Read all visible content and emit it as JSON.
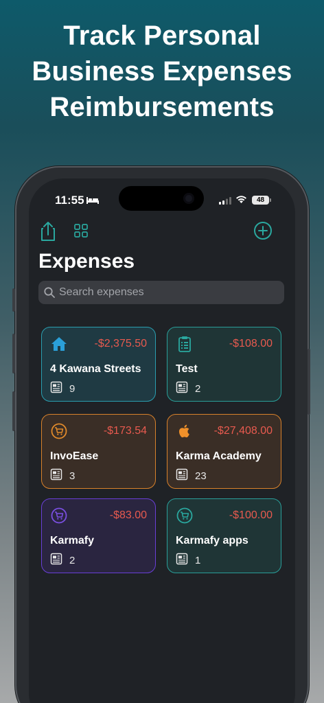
{
  "headline": {
    "line1": "Track Personal",
    "line2": "Business Expenses",
    "line3": "Reimbursements"
  },
  "status_bar": {
    "time": "11:55",
    "battery": "48"
  },
  "screen": {
    "title": "Expenses",
    "search_placeholder": "Search expenses",
    "cards": [
      {
        "name": "4 Kawana Streets",
        "amount": "-$2,375.50",
        "count": "9",
        "icon": "house-icon",
        "border": "#2a9fb0",
        "bg": "#1f3a43",
        "iconColor": "#2a9fd8"
      },
      {
        "name": "Test",
        "amount": "-$108.00",
        "count": "2",
        "icon": "clipboard-icon",
        "border": "#2a9f9a",
        "bg": "#1f3536",
        "iconColor": "#2aa89f"
      },
      {
        "name": "InvoEase",
        "amount": "-$173.54",
        "count": "3",
        "icon": "cart-icon",
        "border": "#d9822b",
        "bg": "#3a2e26",
        "iconColor": "#e08a2b"
      },
      {
        "name": "Karma Academy",
        "amount": "-$27,408.00",
        "count": "23",
        "icon": "apple-icon",
        "border": "#d9822b",
        "bg": "#3a2e26",
        "iconColor": "#f0902a"
      },
      {
        "name": "Karmafy",
        "amount": "-$83.00",
        "count": "2",
        "icon": "cart-icon",
        "border": "#6a3fd8",
        "bg": "#2a2540",
        "iconColor": "#7a4fe0"
      },
      {
        "name": "Karmafy apps",
        "amount": "-$100.00",
        "count": "1",
        "icon": "cart-icon",
        "border": "#2a9f9a",
        "bg": "#1f3536",
        "iconColor": "#2aa89f"
      }
    ]
  },
  "colors": {
    "accent": "#2aa89f",
    "negative_amount": "#e85a4f"
  }
}
